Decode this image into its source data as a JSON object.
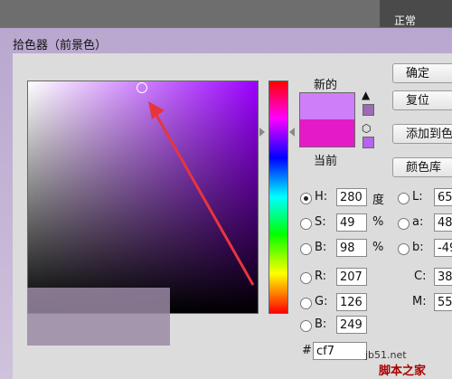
{
  "background_panel": {
    "mode_label": "正常"
  },
  "dialog": {
    "title": "拾色器（前景色）"
  },
  "preview": {
    "new_label": "新的",
    "current_label": "当前",
    "new_color": "#cf7ef9",
    "current_color": "#e41ac8"
  },
  "buttons": {
    "ok": "确定",
    "reset": "复位",
    "add_swatch": "添加到色",
    "libraries": "颜色库"
  },
  "hsb": {
    "h": {
      "label": "H:",
      "value": "280",
      "unit": "度"
    },
    "s": {
      "label": "S:",
      "value": "49",
      "unit": "%"
    },
    "b": {
      "label": "B:",
      "value": "98",
      "unit": "%"
    }
  },
  "rgb": {
    "r": {
      "label": "R:",
      "value": "207"
    },
    "g": {
      "label": "G:",
      "value": "126"
    },
    "b": {
      "label": "B:",
      "value": "249"
    }
  },
  "lab": {
    "l": {
      "label": "L:",
      "value": "65"
    },
    "a": {
      "label": "a:",
      "value": "48"
    },
    "b": {
      "label": "b:",
      "value": "-49"
    }
  },
  "cmyk": {
    "c": {
      "label": "C:",
      "value": "38"
    },
    "m": {
      "label": "M:",
      "value": "55"
    }
  },
  "hex": {
    "label": "#",
    "value": "cf7"
  },
  "watermark": {
    "site": "jb51.net",
    "name": "脚本之家"
  },
  "icons": {
    "warning": "warning-icon",
    "cube": "websafe-cube-icon"
  }
}
